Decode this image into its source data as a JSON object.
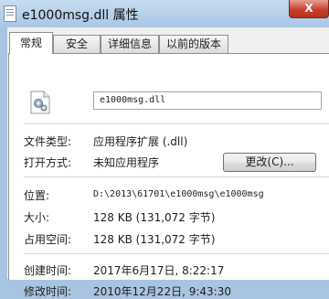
{
  "window": {
    "title": "e1000msg.dll 属性",
    "close_label": "X"
  },
  "tabs": [
    {
      "label": "常规",
      "active": true
    },
    {
      "label": "安全",
      "active": false
    },
    {
      "label": "详细信息",
      "active": false
    },
    {
      "label": "以前的版本",
      "active": false
    }
  ],
  "general": {
    "file_icon": "dll-settings-file-icon",
    "filename": "e1000msg.dll",
    "file_type_label": "文件类型:",
    "file_type_value": "应用程序扩展 (.dll)",
    "opens_with_label": "打开方式:",
    "opens_with_value": "未知应用程序",
    "change_button": "更改(C)...",
    "location_label": "位置:",
    "location_value": "D:\\2013\\61701\\e1000msg\\e1000msg",
    "size_label": "大小:",
    "size_value": "128 KB (131,072 字节)",
    "size_on_disk_label": "占用空间:",
    "size_on_disk_value": "128 KB (131,072 字节)",
    "created_label": "创建时间:",
    "created_value": "2017年6月17日, 8:22:17",
    "modified_label": "修改时间:",
    "modified_value": "2010年12月22日, 9:43:30"
  },
  "colors": {
    "frame": "#a9c4e0",
    "close_button": "#c7402c",
    "panel": "#ffffff",
    "dialog": "#f0f0f0"
  }
}
